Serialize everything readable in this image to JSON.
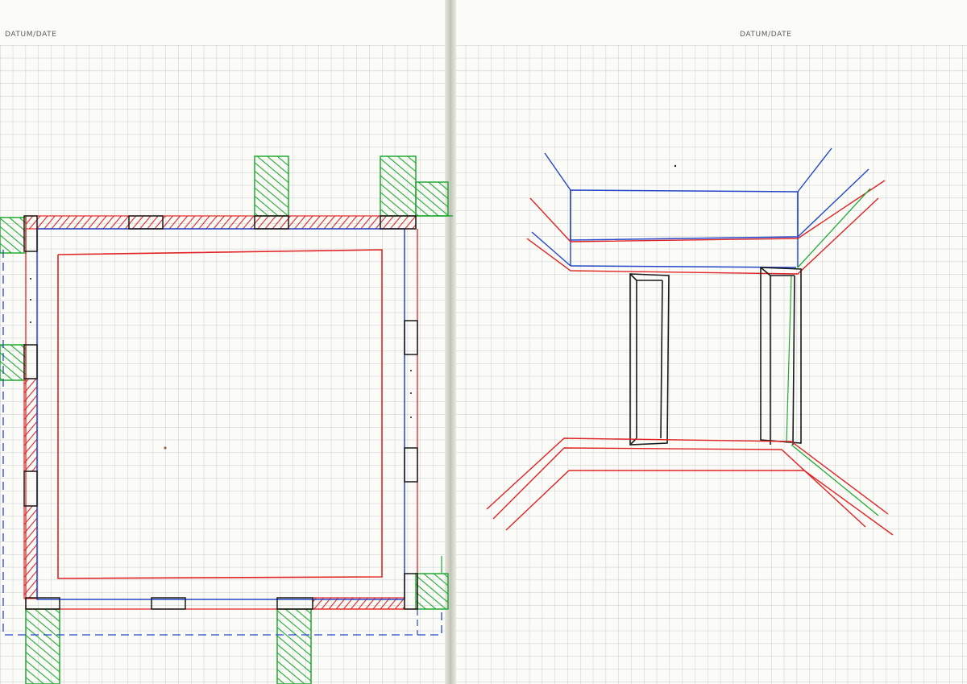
{
  "pages": {
    "left": {
      "date_label": "DATUM/DATE"
    },
    "right": {
      "date_label": "DATUM/DATE"
    }
  },
  "colors": {
    "paper": "#fbfbf8",
    "grid": "#b9bcc0",
    "red_ink": "#e02424",
    "blue_ink": "#2446c8",
    "green_ink": "#22aa33",
    "black_ink": "#1a1a1a"
  }
}
